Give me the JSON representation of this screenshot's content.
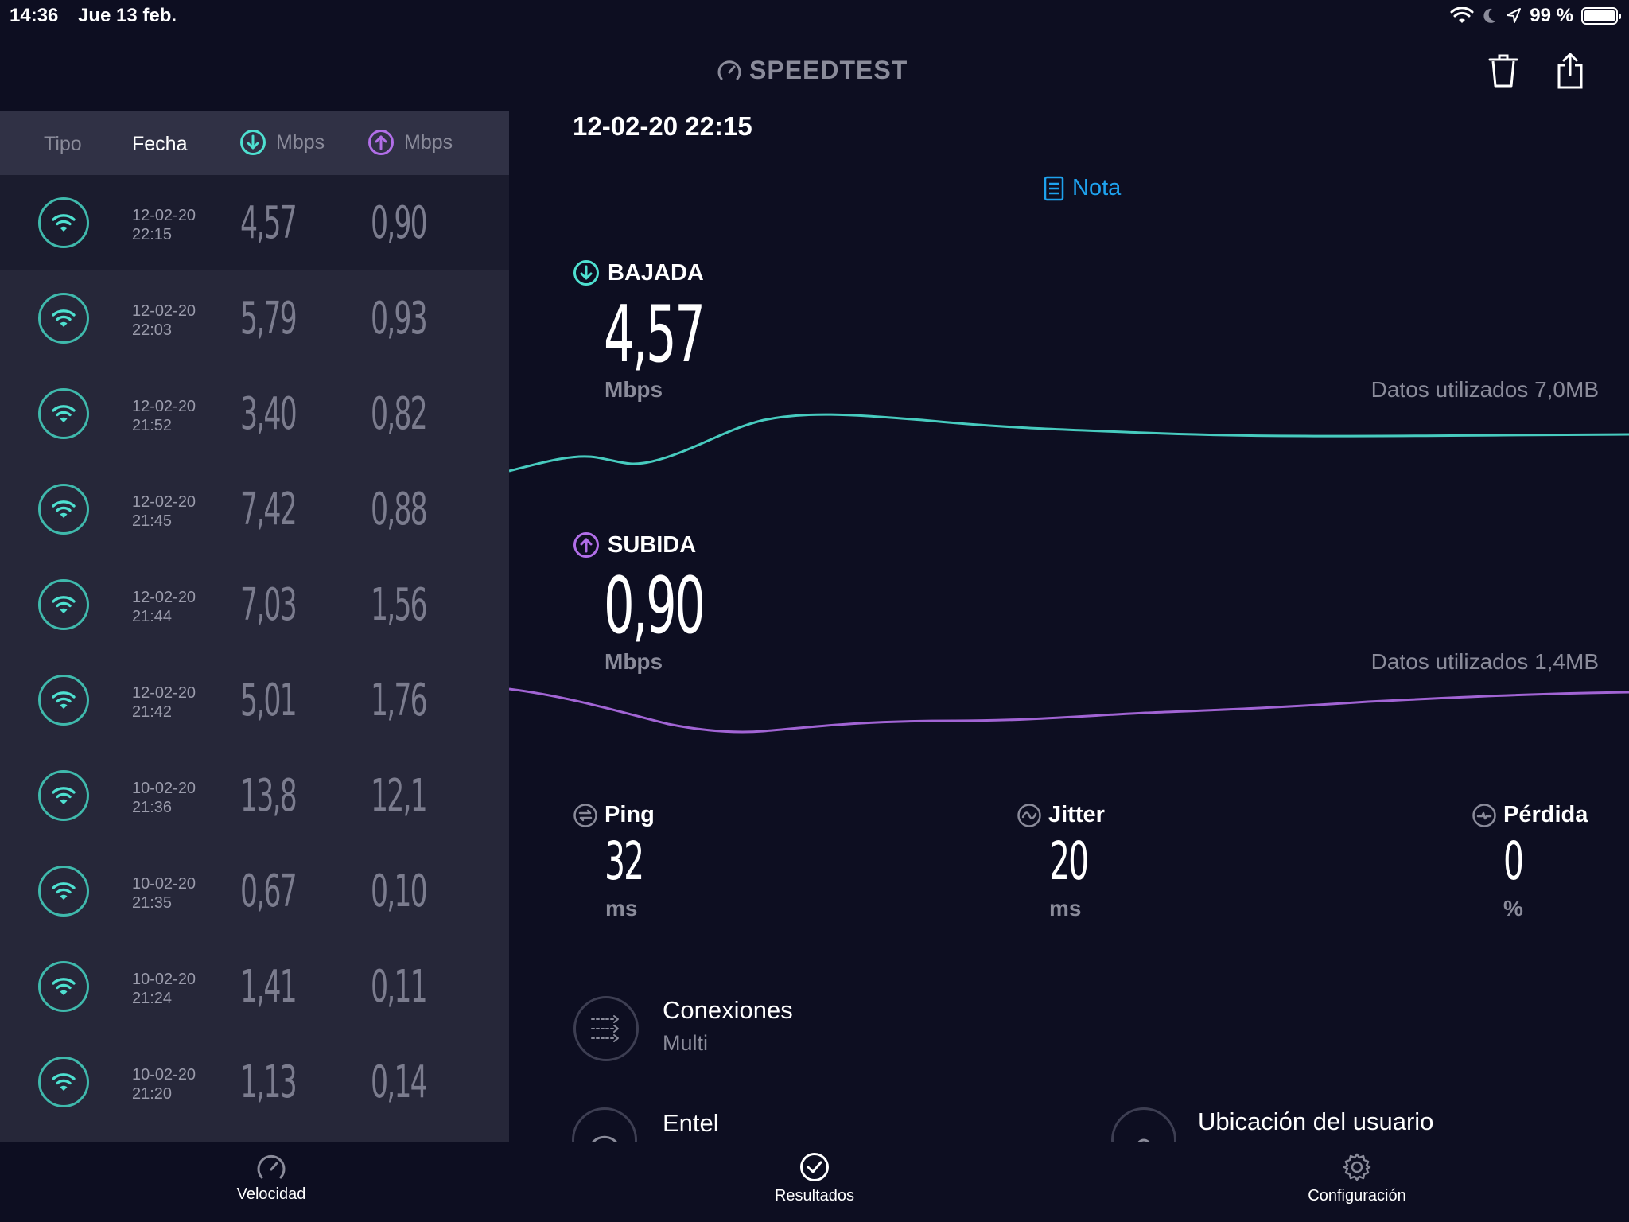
{
  "status_bar": {
    "time": "14:36",
    "date": "Jue 13 feb.",
    "battery_pct": "99 %"
  },
  "header": {
    "brand": "SPEEDTEST",
    "icons": [
      "speedometer-icon",
      "trash-icon",
      "share-icon"
    ]
  },
  "history": {
    "columns": {
      "tipo": "Tipo",
      "fecha": "Fecha",
      "down_unit": "Mbps",
      "up_unit": "Mbps"
    },
    "rows": [
      {
        "date": "12-02-20",
        "time": "22:15",
        "down": "4,57",
        "up": "0,90"
      },
      {
        "date": "12-02-20",
        "time": "22:03",
        "down": "5,79",
        "up": "0,93"
      },
      {
        "date": "12-02-20",
        "time": "21:52",
        "down": "3,40",
        "up": "0,82"
      },
      {
        "date": "12-02-20",
        "time": "21:45",
        "down": "7,42",
        "up": "0,88"
      },
      {
        "date": "12-02-20",
        "time": "21:44",
        "down": "7,03",
        "up": "1,56"
      },
      {
        "date": "12-02-20",
        "time": "21:42",
        "down": "5,01",
        "up": "1,76"
      },
      {
        "date": "10-02-20",
        "time": "21:36",
        "down": "13,8",
        "up": "12,1"
      },
      {
        "date": "10-02-20",
        "time": "21:35",
        "down": "0,67",
        "up": "0,10"
      },
      {
        "date": "10-02-20",
        "time": "21:24",
        "down": "1,41",
        "up": "0,11"
      },
      {
        "date": "10-02-20",
        "time": "21:20",
        "down": "1,13",
        "up": "0,14"
      }
    ]
  },
  "result": {
    "datetime": "12-02-20 22:15",
    "note_label": "Nota",
    "download": {
      "title": "BAJADA",
      "value": "4,57",
      "unit": "Mbps",
      "data_used": "Datos utilizados 7,0MB"
    },
    "upload": {
      "title": "SUBIDA",
      "value": "0,90",
      "unit": "Mbps",
      "data_used": "Datos utilizados 1,4MB"
    },
    "ping": {
      "title": "Ping",
      "value": "32",
      "unit": "ms"
    },
    "jitter": {
      "title": "Jitter",
      "value": "20",
      "unit": "ms"
    },
    "loss": {
      "title": "Pérdida",
      "value": "0",
      "unit": "%"
    },
    "connections": {
      "title": "Conexiones",
      "value": "Multi"
    },
    "provider": {
      "title": "Entel"
    },
    "location": {
      "title": "Ubicación del usuario"
    }
  },
  "tabs": {
    "velocidad": "Velocidad",
    "resultados": "Resultados",
    "configuracion": "Configuración"
  },
  "colors": {
    "background": "#0d0e21",
    "sidebar": "#262739",
    "download_accent": "#4ee0d0",
    "upload_accent": "#b16ee8",
    "link": "#1ea2ee"
  }
}
